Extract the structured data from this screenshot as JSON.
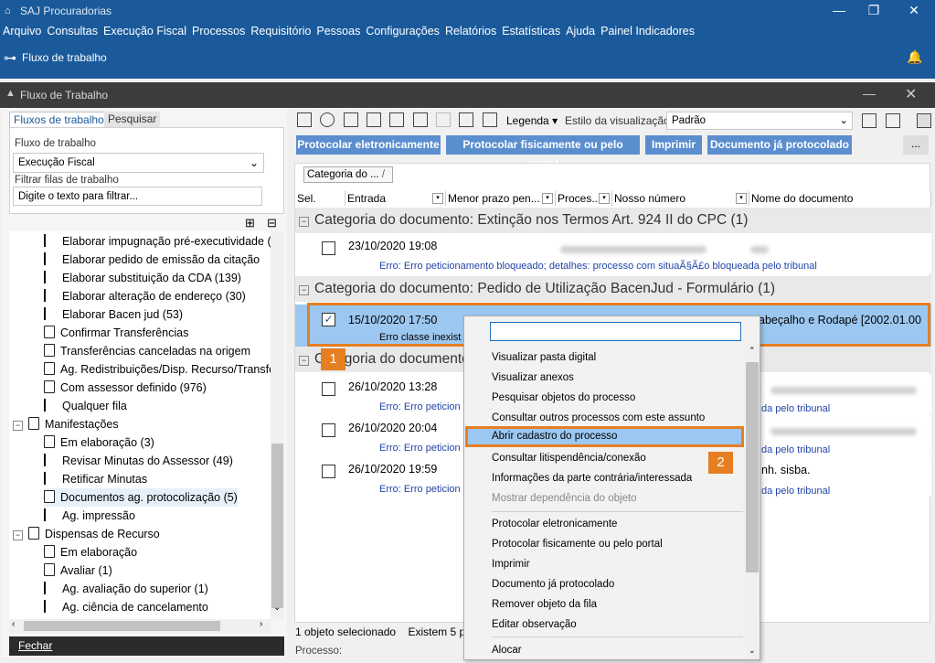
{
  "app": {
    "title": "SAJ Procuradorias",
    "menu": [
      "Arquivo",
      "Consultas",
      "Execução Fiscal",
      "Processos",
      "Requisitório",
      "Pessoas",
      "Configurações",
      "Relatórios",
      "Estatísticas",
      "Ajuda",
      "Painel Indicadores"
    ],
    "workflow_link": "Fluxo de trabalho"
  },
  "window": {
    "title": "Fluxo de Trabalho"
  },
  "left": {
    "tabs": [
      "Fluxos de trabalho",
      "Pesquisar"
    ],
    "flow_label": "Fluxo de trabalho",
    "flow_value": "Execução Fiscal",
    "filter_label": "Filtrar filas de trabalho",
    "filter_placeholder": "Digite o texto para filtrar...",
    "tree": [
      {
        "label": "Elaborar impugnação pré-executividade (16",
        "level": 2,
        "icon": "flag-icon"
      },
      {
        "label": "Elaborar pedido de emissão da citação",
        "level": 2,
        "icon": "flag-icon"
      },
      {
        "label": "Elaborar substituição da CDA (139)",
        "level": 2,
        "icon": "flag-icon"
      },
      {
        "label": "Elaborar alteração de endereço (30)",
        "level": 2,
        "icon": "flag-icon"
      },
      {
        "label": "Elaborar Bacen jud (53)",
        "level": 2,
        "icon": "flag-icon"
      },
      {
        "label": "Confirmar Transferências",
        "level": 2,
        "icon": "list-icon"
      },
      {
        "label": "Transferências canceladas na origem",
        "level": 2,
        "icon": "list-icon"
      },
      {
        "label": "Ag. Redistribuições/Disp. Recurso/Transfer",
        "level": 2,
        "icon": "list-icon"
      },
      {
        "label": "Com assessor definido (976)",
        "level": 2,
        "icon": "list-icon"
      },
      {
        "label": "Qualquer fila",
        "level": 2,
        "icon": "flag-icon"
      },
      {
        "label": "Manifestações",
        "level": 1,
        "icon": "folder-icon",
        "expander": "−"
      },
      {
        "label": "Em elaboração (3)",
        "level": 2,
        "icon": "doc-icon"
      },
      {
        "label": "Revisar Minutas do Assessor (49)",
        "level": 2,
        "icon": "flag-icon"
      },
      {
        "label": "Retificar Minutas",
        "level": 2,
        "icon": "flag-icon"
      },
      {
        "label": "Documentos ag. protocolização (5)",
        "level": 2,
        "icon": "stamp-icon",
        "selected": true
      },
      {
        "label": "Ag. impressão",
        "level": 2,
        "icon": "flag-icon"
      },
      {
        "label": "Dispensas de Recurso",
        "level": 1,
        "icon": "list-icon",
        "expander": "−"
      },
      {
        "label": "Em elaboração",
        "level": 2,
        "icon": "doc-icon"
      },
      {
        "label": "Avaliar (1)",
        "level": 2,
        "icon": "doc-icon"
      },
      {
        "label": "Ag. avaliação do superior (1)",
        "level": 2,
        "icon": "flag-icon"
      },
      {
        "label": "Ag. ciência de cancelamento",
        "level": 2,
        "icon": "flag-icon"
      }
    ],
    "close_label": "Fechar"
  },
  "toolbar": {
    "legend": "Legenda",
    "view_style_label": "Estilo da visualização",
    "view_style_value": "Padrão",
    "buttons": [
      "Protocolar eletronicamente",
      "Protocolar fisicamente ou pelo portal",
      "Imprimir",
      "Documento já protocolado"
    ],
    "more": "..."
  },
  "grid": {
    "group_chip": "Categoria do ...",
    "columns": [
      "Sel.",
      "Entrada",
      "Menor prazo pen...",
      "Proces...",
      "Nosso número",
      "Nome do documento"
    ],
    "groups": [
      {
        "title": "Categoria do documento: Extinção nos Termos Art. 924 II do CPC  (1)"
      },
      {
        "title": "Categoria do documento: Pedido de Utilização BacenJud - Formulário  (1)"
      },
      {
        "title": "Categoria do documento"
      }
    ],
    "rows": [
      {
        "date": "23/10/2020 19:08",
        "error": "Erro: Erro peticionamento bloqueado; detalhes: processo com situaÃ§Ã£o bloqueada pelo tribunal"
      },
      {
        "date": "15/10/2020 17:50",
        "error": "Erro classe inexist",
        "doc": "Cabeçalho e Rodapé [2002.01.00"
      },
      {
        "date": "26/10/2020 13:28",
        "error": "Erro: Erro peticion",
        "tail": "da pelo tribunal"
      },
      {
        "date": "26/10/2020 20:04",
        "error": "Erro: Erro peticion",
        "tail": "da pelo tribunal"
      },
      {
        "date": "26/10/2020 19:59",
        "error": "Erro: Erro peticion",
        "tail": "da pelo tribunal",
        "doc": "nh. sisba."
      }
    ]
  },
  "badges": [
    "1",
    "2"
  ],
  "status": {
    "selected": "1 objeto selecionado",
    "exist": "Existem 5 p",
    "process_label": "Processo:"
  },
  "context_menu": {
    "items": [
      "Visualizar pasta digital",
      "Visualizar anexos",
      "Pesquisar objetos do processo",
      "Consultar outros processos com este assunto",
      "Abrir cadastro do processo",
      "Consultar litispendência/conexão",
      "Informações da parte contrária/interessada",
      "Mostrar dependência do objeto",
      "Protocolar eletronicamente",
      "Protocolar fisicamente ou pelo portal",
      "Imprimir",
      "Documento já protocolado",
      "Remover objeto da fila",
      "Editar observação",
      "Alocar"
    ]
  },
  "colors": {
    "appbar": "#1a5a9b",
    "accent": "#e67e22",
    "selection": "#9bc7f0",
    "button": "#5b8ecf"
  }
}
